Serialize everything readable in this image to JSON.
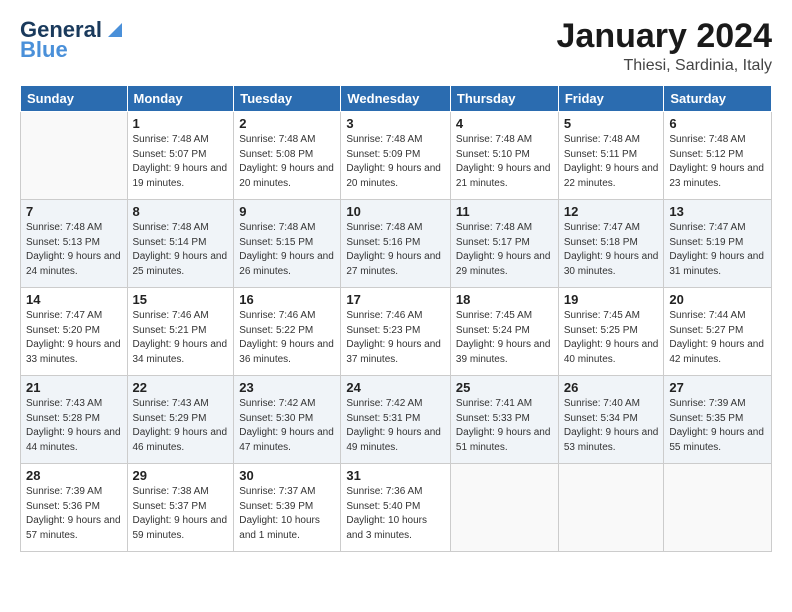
{
  "header": {
    "logo_line1": "General",
    "logo_line2": "Blue",
    "month": "January 2024",
    "location": "Thiesi, Sardinia, Italy"
  },
  "weekdays": [
    "Sunday",
    "Monday",
    "Tuesday",
    "Wednesday",
    "Thursday",
    "Friday",
    "Saturday"
  ],
  "weeks": [
    [
      {
        "day": "",
        "sunrise": "",
        "sunset": "",
        "daylight": ""
      },
      {
        "day": "1",
        "sunrise": "Sunrise: 7:48 AM",
        "sunset": "Sunset: 5:07 PM",
        "daylight": "Daylight: 9 hours and 19 minutes."
      },
      {
        "day": "2",
        "sunrise": "Sunrise: 7:48 AM",
        "sunset": "Sunset: 5:08 PM",
        "daylight": "Daylight: 9 hours and 20 minutes."
      },
      {
        "day": "3",
        "sunrise": "Sunrise: 7:48 AM",
        "sunset": "Sunset: 5:09 PM",
        "daylight": "Daylight: 9 hours and 20 minutes."
      },
      {
        "day": "4",
        "sunrise": "Sunrise: 7:48 AM",
        "sunset": "Sunset: 5:10 PM",
        "daylight": "Daylight: 9 hours and 21 minutes."
      },
      {
        "day": "5",
        "sunrise": "Sunrise: 7:48 AM",
        "sunset": "Sunset: 5:11 PM",
        "daylight": "Daylight: 9 hours and 22 minutes."
      },
      {
        "day": "6",
        "sunrise": "Sunrise: 7:48 AM",
        "sunset": "Sunset: 5:12 PM",
        "daylight": "Daylight: 9 hours and 23 minutes."
      }
    ],
    [
      {
        "day": "7",
        "sunrise": "Sunrise: 7:48 AM",
        "sunset": "Sunset: 5:13 PM",
        "daylight": "Daylight: 9 hours and 24 minutes."
      },
      {
        "day": "8",
        "sunrise": "Sunrise: 7:48 AM",
        "sunset": "Sunset: 5:14 PM",
        "daylight": "Daylight: 9 hours and 25 minutes."
      },
      {
        "day": "9",
        "sunrise": "Sunrise: 7:48 AM",
        "sunset": "Sunset: 5:15 PM",
        "daylight": "Daylight: 9 hours and 26 minutes."
      },
      {
        "day": "10",
        "sunrise": "Sunrise: 7:48 AM",
        "sunset": "Sunset: 5:16 PM",
        "daylight": "Daylight: 9 hours and 27 minutes."
      },
      {
        "day": "11",
        "sunrise": "Sunrise: 7:48 AM",
        "sunset": "Sunset: 5:17 PM",
        "daylight": "Daylight: 9 hours and 29 minutes."
      },
      {
        "day": "12",
        "sunrise": "Sunrise: 7:47 AM",
        "sunset": "Sunset: 5:18 PM",
        "daylight": "Daylight: 9 hours and 30 minutes."
      },
      {
        "day": "13",
        "sunrise": "Sunrise: 7:47 AM",
        "sunset": "Sunset: 5:19 PM",
        "daylight": "Daylight: 9 hours and 31 minutes."
      }
    ],
    [
      {
        "day": "14",
        "sunrise": "Sunrise: 7:47 AM",
        "sunset": "Sunset: 5:20 PM",
        "daylight": "Daylight: 9 hours and 33 minutes."
      },
      {
        "day": "15",
        "sunrise": "Sunrise: 7:46 AM",
        "sunset": "Sunset: 5:21 PM",
        "daylight": "Daylight: 9 hours and 34 minutes."
      },
      {
        "day": "16",
        "sunrise": "Sunrise: 7:46 AM",
        "sunset": "Sunset: 5:22 PM",
        "daylight": "Daylight: 9 hours and 36 minutes."
      },
      {
        "day": "17",
        "sunrise": "Sunrise: 7:46 AM",
        "sunset": "Sunset: 5:23 PM",
        "daylight": "Daylight: 9 hours and 37 minutes."
      },
      {
        "day": "18",
        "sunrise": "Sunrise: 7:45 AM",
        "sunset": "Sunset: 5:24 PM",
        "daylight": "Daylight: 9 hours and 39 minutes."
      },
      {
        "day": "19",
        "sunrise": "Sunrise: 7:45 AM",
        "sunset": "Sunset: 5:25 PM",
        "daylight": "Daylight: 9 hours and 40 minutes."
      },
      {
        "day": "20",
        "sunrise": "Sunrise: 7:44 AM",
        "sunset": "Sunset: 5:27 PM",
        "daylight": "Daylight: 9 hours and 42 minutes."
      }
    ],
    [
      {
        "day": "21",
        "sunrise": "Sunrise: 7:43 AM",
        "sunset": "Sunset: 5:28 PM",
        "daylight": "Daylight: 9 hours and 44 minutes."
      },
      {
        "day": "22",
        "sunrise": "Sunrise: 7:43 AM",
        "sunset": "Sunset: 5:29 PM",
        "daylight": "Daylight: 9 hours and 46 minutes."
      },
      {
        "day": "23",
        "sunrise": "Sunrise: 7:42 AM",
        "sunset": "Sunset: 5:30 PM",
        "daylight": "Daylight: 9 hours and 47 minutes."
      },
      {
        "day": "24",
        "sunrise": "Sunrise: 7:42 AM",
        "sunset": "Sunset: 5:31 PM",
        "daylight": "Daylight: 9 hours and 49 minutes."
      },
      {
        "day": "25",
        "sunrise": "Sunrise: 7:41 AM",
        "sunset": "Sunset: 5:33 PM",
        "daylight": "Daylight: 9 hours and 51 minutes."
      },
      {
        "day": "26",
        "sunrise": "Sunrise: 7:40 AM",
        "sunset": "Sunset: 5:34 PM",
        "daylight": "Daylight: 9 hours and 53 minutes."
      },
      {
        "day": "27",
        "sunrise": "Sunrise: 7:39 AM",
        "sunset": "Sunset: 5:35 PM",
        "daylight": "Daylight: 9 hours and 55 minutes."
      }
    ],
    [
      {
        "day": "28",
        "sunrise": "Sunrise: 7:39 AM",
        "sunset": "Sunset: 5:36 PM",
        "daylight": "Daylight: 9 hours and 57 minutes."
      },
      {
        "day": "29",
        "sunrise": "Sunrise: 7:38 AM",
        "sunset": "Sunset: 5:37 PM",
        "daylight": "Daylight: 9 hours and 59 minutes."
      },
      {
        "day": "30",
        "sunrise": "Sunrise: 7:37 AM",
        "sunset": "Sunset: 5:39 PM",
        "daylight": "Daylight: 10 hours and 1 minute."
      },
      {
        "day": "31",
        "sunrise": "Sunrise: 7:36 AM",
        "sunset": "Sunset: 5:40 PM",
        "daylight": "Daylight: 10 hours and 3 minutes."
      },
      {
        "day": "",
        "sunrise": "",
        "sunset": "",
        "daylight": ""
      },
      {
        "day": "",
        "sunrise": "",
        "sunset": "",
        "daylight": ""
      },
      {
        "day": "",
        "sunrise": "",
        "sunset": "",
        "daylight": ""
      }
    ]
  ]
}
